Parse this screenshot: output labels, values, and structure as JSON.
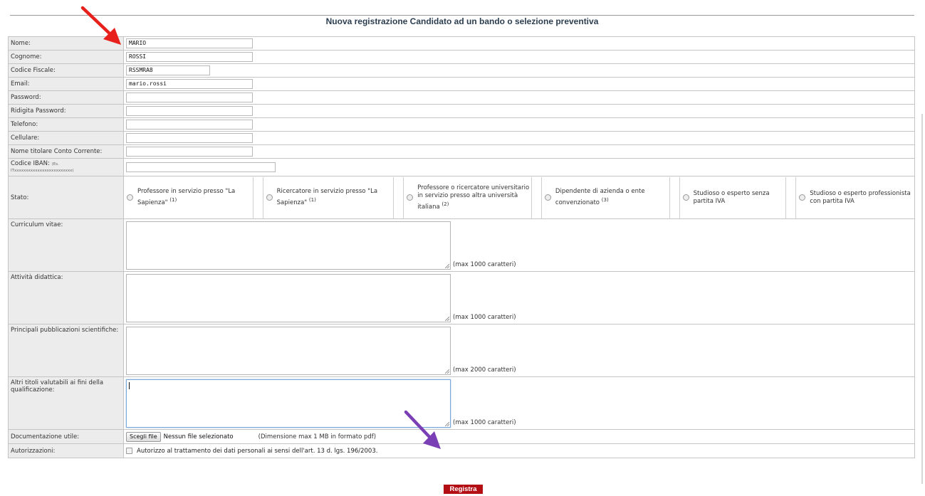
{
  "title": "Nuova registrazione Candidato ad un bando o selezione preventiva",
  "fields": {
    "nome": {
      "label": "Nome:",
      "value": "MARIO"
    },
    "cognome": {
      "label": "Cognome:",
      "value": "ROSSI"
    },
    "codice_fiscale": {
      "label": "Codice Fiscale:",
      "value": "RSSMRA8"
    },
    "email": {
      "label": "Email:",
      "value": "mario.rossi"
    },
    "password": {
      "label": "Password:",
      "value": ""
    },
    "ridigita_password": {
      "label": "Ridigita Password:",
      "value": ""
    },
    "telefono": {
      "label": "Telefono:",
      "value": ""
    },
    "cellulare": {
      "label": "Cellulare:",
      "value": ""
    },
    "titolare": {
      "label": "Nome titolare Conto Corrente:",
      "value": ""
    },
    "iban": {
      "label": "Codice IBAN:",
      "hint": "(Es. ITxxxxxxxxxxxxxxxxxxxxxxxxx)",
      "value": ""
    }
  },
  "stato": {
    "label": "Stato:",
    "options": [
      {
        "label": "Professore in servizio presso \"La Sapienza\"",
        "note": "(1)"
      },
      {
        "label": "Ricercatore in servizio presso \"La Sapienza\"",
        "note": "(1)"
      },
      {
        "label": "Professore o ricercatore universitario in servizio presso altra università italiana",
        "note": "(2)"
      },
      {
        "label": "Dipendente di azienda o ente convenzionato",
        "note": "(3)"
      },
      {
        "label": "Studioso o esperto senza partita IVA",
        "note": ""
      },
      {
        "label": "Studioso o esperto professionista con partita IVA",
        "note": ""
      }
    ]
  },
  "textareas": {
    "curriculum": {
      "label": "Curriculum vitae:",
      "max": "(max 1000 caratteri)"
    },
    "didattica": {
      "label": "Attività didattica:",
      "max": "(max 1000 caratteri)"
    },
    "pubblicazioni": {
      "label": "Principali pubblicazioni scientifiche:",
      "max": "(max 2000 caratteri)"
    },
    "altri_titoli": {
      "label": "Altri titoli valutabili ai fini della qualificazione:",
      "max": "(max 1000 caratteri)"
    }
  },
  "documentazione": {
    "label": "Documentazione utile:",
    "button": "Scegli file",
    "filename": "Nessun file selezionato",
    "size_note": "(Dimensione max 1 MB in formato pdf)"
  },
  "autorizzazioni": {
    "label": "Autorizzazioni:",
    "text": "Autorizzo al trattamento dei dati personali ai sensi dell'art. 13 d. lgs. 196/2003."
  },
  "submit_label": "Registra",
  "colors": {
    "submit_bg": "#b30e13",
    "arrow_red": "#e8201c",
    "arrow_purple": "#7b3fb5"
  }
}
